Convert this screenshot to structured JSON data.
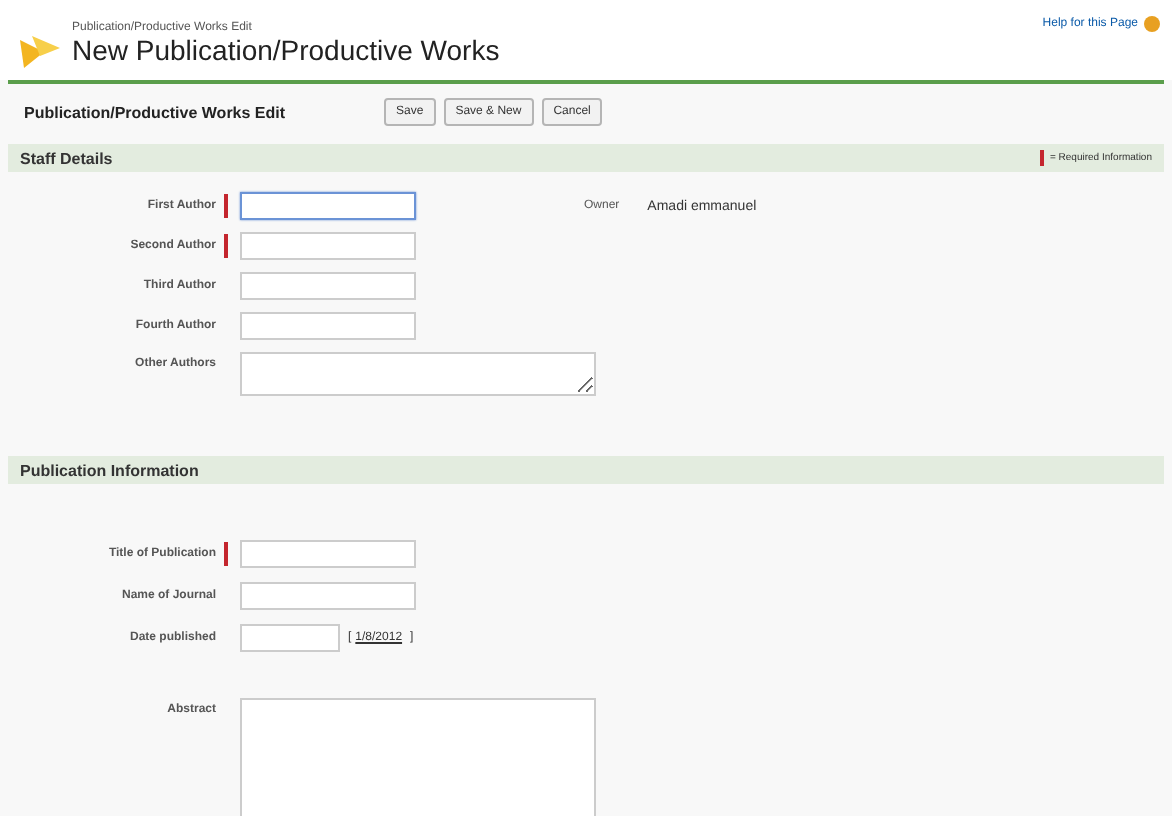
{
  "header": {
    "breadcrumb": "Publication/Productive Works Edit",
    "title": "New Publication/Productive Works",
    "help_link": "Help for this Page"
  },
  "toolbar": {
    "title": "Publication/Productive Works Edit",
    "buttons": [
      "Save",
      "Save & New",
      "Cancel"
    ]
  },
  "sections": [
    {
      "title": "Staff Details",
      "required_legend": "= Required Information",
      "side_label": "Owner",
      "side_value": "Amadi emmanuel",
      "fields": [
        {
          "label": "First Author",
          "kind": "input",
          "required": true,
          "focused": true
        },
        {
          "label": "Second Author",
          "kind": "input",
          "required": true,
          "focused": false
        },
        {
          "label": "Third Author",
          "kind": "input",
          "required": false,
          "focused": false
        },
        {
          "label": "Fourth Author",
          "kind": "input",
          "required": false,
          "focused": false
        },
        {
          "label": "Other Authors",
          "kind": "textarea",
          "required": false,
          "focused": false
        }
      ]
    },
    {
      "title": "Publication Information",
      "fields": [
        {
          "label": "Title of Publication",
          "kind": "input",
          "required": true,
          "focused": false
        },
        {
          "label": "Name of Journal",
          "kind": "input",
          "required": false,
          "focused": false
        },
        {
          "label": "Date published",
          "kind": "date",
          "required": false,
          "focused": false,
          "prefix": "[",
          "link": "1/8/2012",
          "suffix": "]"
        },
        {
          "label": "Abstract",
          "kind": "bigtext",
          "required": false,
          "focused": false
        }
      ]
    }
  ]
}
